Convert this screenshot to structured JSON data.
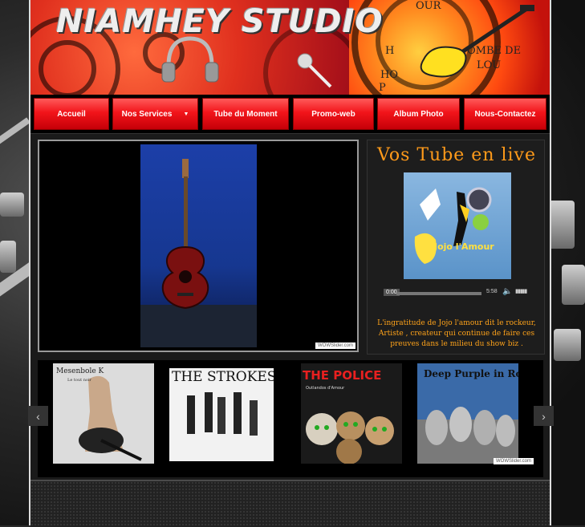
{
  "site": {
    "brand": "NIAMHEY STUDIO",
    "banner_words": [
      "OUR",
      "OMBE DE",
      "LOU",
      "H",
      "HO",
      "P"
    ]
  },
  "nav": {
    "items": [
      {
        "label": "Accueil"
      },
      {
        "label": "Nos Services",
        "has_dropdown": true
      },
      {
        "label": "Tube du Moment"
      },
      {
        "label": "Promo-web"
      },
      {
        "label": "Album Photo"
      },
      {
        "label": "Nous-Contactez"
      }
    ]
  },
  "slider": {
    "watermark": "WOWSlider.com",
    "image_icon": "acoustic-guitar-photo"
  },
  "live": {
    "title": "Vos Tube en live",
    "album_icon": "jojo-lamour-album-cover",
    "album_text": "Jojo l'Amour",
    "player": {
      "current_time": "0:00",
      "duration": "5:58",
      "progress": 0
    },
    "caption": "L'ingratitude de Jojo l'amour dit le rockeur, Artiste , createur qui continue de faire ces preuves dans le milieu du show biz ."
  },
  "carousel": {
    "watermark": "WOWSlider.com",
    "albums": [
      {
        "title": "Mesenbole K",
        "subtitle": "Le tout noir"
      },
      {
        "title": "THE STROKES"
      },
      {
        "title": "THE POLICE",
        "subtitle": "Outlandos d'Amour"
      },
      {
        "title": "Deep Purple in Rock"
      }
    ],
    "prev_icon": "chevron-left-icon",
    "next_icon": "chevron-right-icon"
  },
  "colors": {
    "nav_red": "#f2141a",
    "accent_orange": "#ff9a1a",
    "banner_red": "#e0301e"
  }
}
